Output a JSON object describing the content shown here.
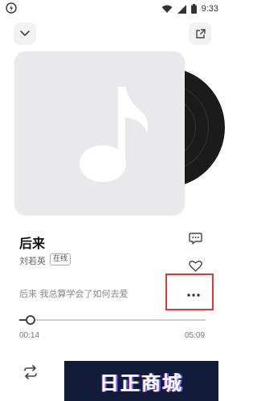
{
  "status_bar": {
    "time": "9:33",
    "icons": [
      "sync-icon",
      "wifi-icon",
      "signal-icon",
      "battery-icon"
    ]
  },
  "top_bar": {
    "left_icon": "chevron-down-icon",
    "right_icon": "share-icon"
  },
  "song": {
    "title": "后来",
    "artist": "刘若英",
    "badge": "在线",
    "lyric": "后来 我总算学会了如何去爱"
  },
  "actions": {
    "comment_icon": "comment-icon",
    "like_icon": "heart-icon",
    "more_icon": "more-icon"
  },
  "player": {
    "current_time": "00:14",
    "duration": "05:09",
    "progress": 0.045,
    "repeat_icon": "repeat-icon"
  },
  "colors": {
    "highlight": "#d83a36",
    "cover_bg": "#e9e9ec",
    "watermark_bg": "#121b37"
  },
  "watermark": {
    "text": "日正商城"
  }
}
